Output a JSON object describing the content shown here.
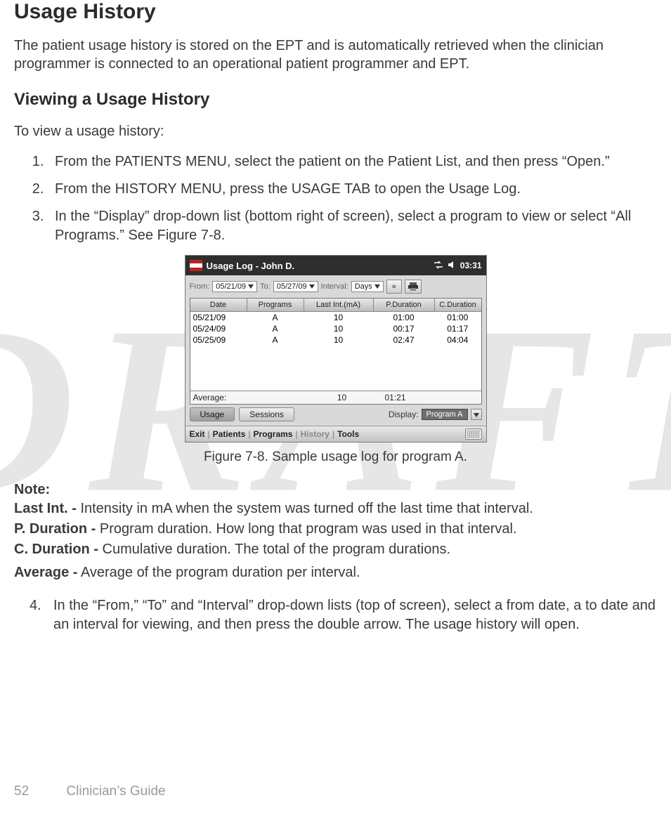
{
  "watermark": "DRAFT",
  "heading": "Usage History",
  "intro": "The patient usage history is stored on the EPT and is automatically retrieved when the clinician programmer is connected to an operational patient programmer and EPT.",
  "subheading": "Viewing a Usage History",
  "lead": "To view a usage history:",
  "steps": {
    "s1": "From the PATIENTS MENU, select the patient on the Patient List, and then press “Open.”",
    "s2": "From the HISTORY MENU, press the USAGE TAB to open the Usage Log.",
    "s3": "In the “Display” drop-down list (bottom right of screen), select a program to view or select “All Programs.” See Figure 7-8.",
    "s4": "In the “From,” “To” and “Interval” drop-down lists (top of screen), select a from date, a to date and an interval for viewing, and then press the double arrow. The usage history will open."
  },
  "figure": {
    "caption": "Figure 7-8. Sample usage log for program A.",
    "title": "Usage Log - John D.",
    "clock": "03:31",
    "filters": {
      "from_label": "From:",
      "from_value": "05/21/09",
      "to_label": "To:",
      "to_value": "05/27/09",
      "interval_label": "Interval:",
      "interval_value": "Days",
      "go": "»"
    },
    "table": {
      "headers": {
        "date": "Date",
        "programs": "Programs",
        "lastint": "Last Int.(mA)",
        "pdur": "P.Duration",
        "cdur": "C.Duration"
      },
      "rows": [
        {
          "date": "05/21/09",
          "programs": "A",
          "lastint": "10",
          "pdur": "01:00",
          "cdur": "01:00"
        },
        {
          "date": "05/24/09",
          "programs": "A",
          "lastint": "10",
          "pdur": "00:17",
          "cdur": "01:17"
        },
        {
          "date": "05/25/09",
          "programs": "A",
          "lastint": "10",
          "pdur": "02:47",
          "cdur": "04:04"
        }
      ],
      "avg_label": "Average:",
      "avg_lastint": "10",
      "avg_pdur": "01:21"
    },
    "tabs": {
      "usage": "Usage",
      "sessions": "Sessions",
      "display_label": "Display:",
      "display_value": "Program A"
    },
    "nav": {
      "exit": "Exit",
      "patients": "Patients",
      "programs": "Programs",
      "history": "History",
      "tools": "Tools"
    }
  },
  "note": {
    "label": "Note:",
    "lastint_term": "Last Int. -",
    "lastint_desc": " Intensity in mA when the system was turned off the last time that interval.",
    "pdur_term": "P. Duration -",
    "pdur_desc": " Program duration. How long that program was used in that interval.",
    "cdur_term": "C. Duration -",
    "cdur_desc": " Cumulative duration. The total of the program durations.",
    "avg_term": "Average -",
    "avg_desc": " Average of the program duration per interval."
  },
  "footer": {
    "page": "52",
    "book": "Clinician’s Guide"
  }
}
